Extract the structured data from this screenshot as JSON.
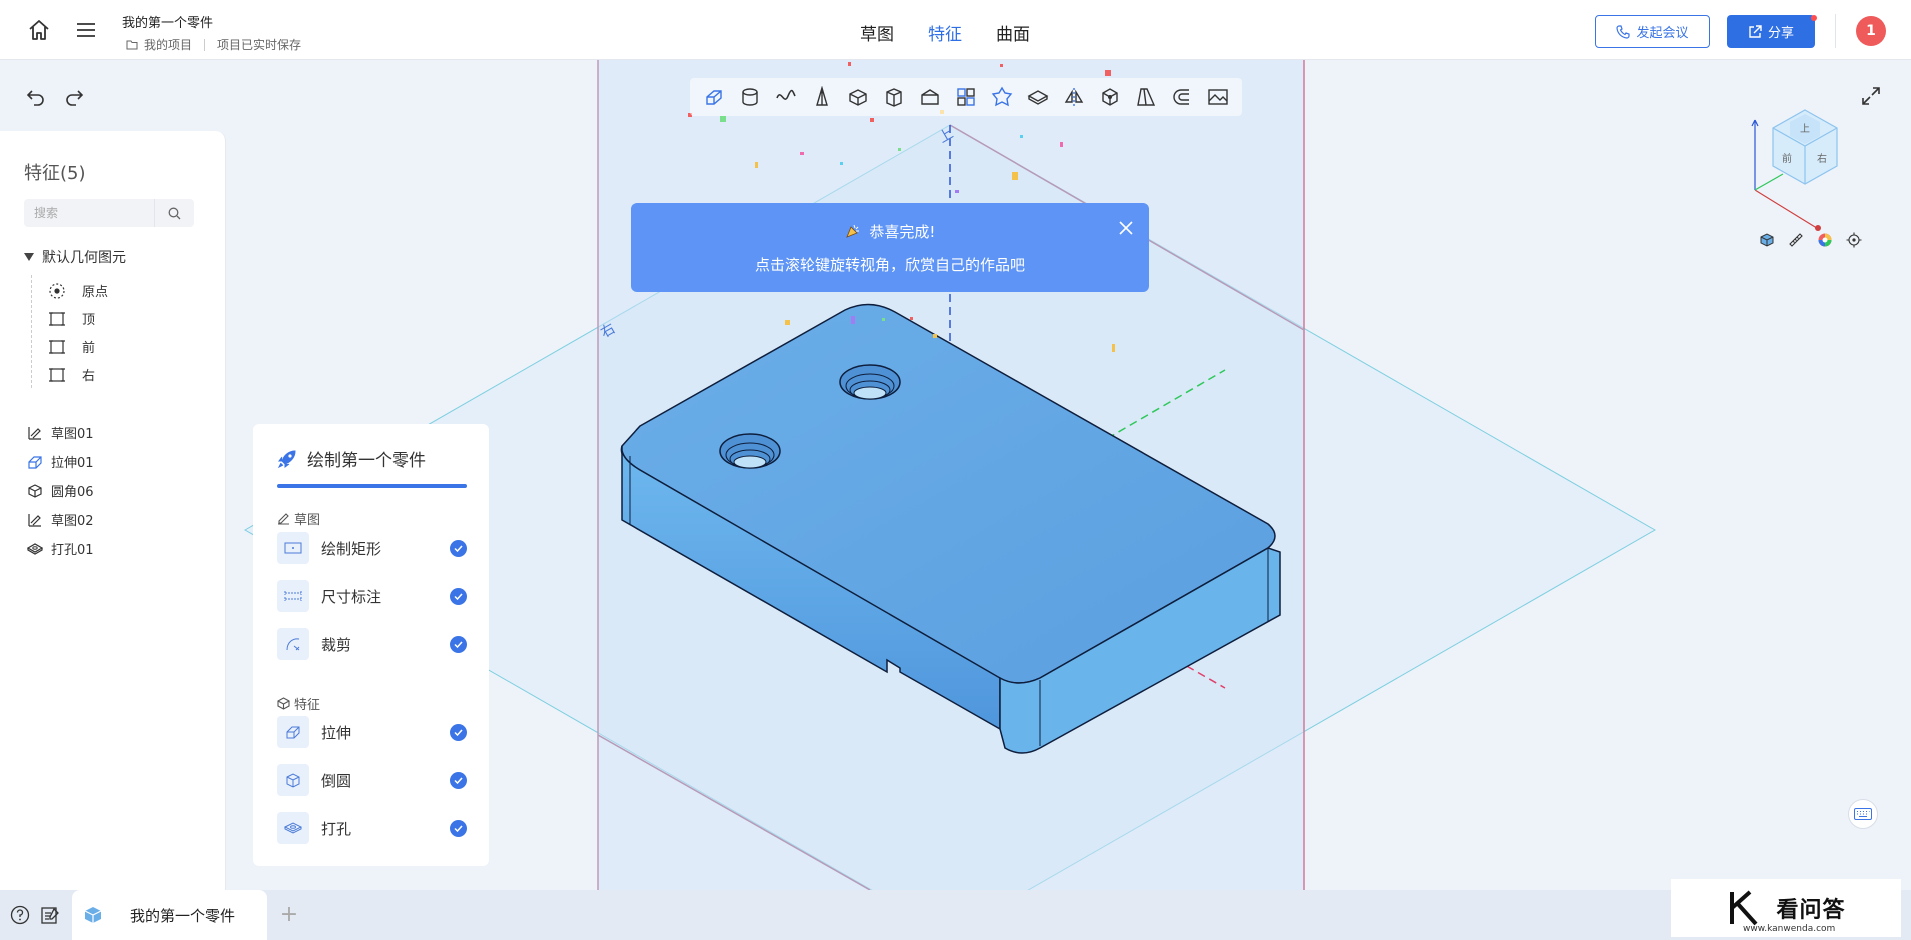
{
  "header": {
    "doc_title": "我的第一个零件",
    "breadcrumb_project": "我的项目",
    "save_status": "项目已实时保存",
    "tabs": [
      {
        "label": "草图",
        "active": false
      },
      {
        "label": "特征",
        "active": true
      },
      {
        "label": "曲面",
        "active": false
      }
    ],
    "meeting_label": "发起会议",
    "share_label": "分享",
    "avatar_label": "1",
    "accent_color": "#2f6fe4"
  },
  "sidebar": {
    "title": "特征(5)",
    "search_placeholder": "搜索",
    "group_label": "默认几何图元",
    "geometry": [
      {
        "label": "原点",
        "icon": "origin-icon"
      },
      {
        "label": "顶",
        "icon": "plane-icon"
      },
      {
        "label": "前",
        "icon": "plane-icon"
      },
      {
        "label": "右",
        "icon": "plane-icon"
      }
    ],
    "features": [
      {
        "label": "草图01",
        "icon": "sketch-icon"
      },
      {
        "label": "拉伸01",
        "icon": "extrude-icon"
      },
      {
        "label": "圆角06",
        "icon": "fillet-icon"
      },
      {
        "label": "草图02",
        "icon": "sketch-icon"
      },
      {
        "label": "打孔01",
        "icon": "hole-icon"
      }
    ]
  },
  "tutorial": {
    "title": "绘制第一个零件",
    "sections": [
      {
        "label": "草图",
        "steps": [
          {
            "label": "绘制矩形",
            "done": true
          },
          {
            "label": "尺寸标注",
            "done": true
          },
          {
            "label": "裁剪",
            "done": true
          }
        ]
      },
      {
        "label": "特征",
        "steps": [
          {
            "label": "拉伸",
            "done": true
          },
          {
            "label": "倒圆",
            "done": true
          },
          {
            "label": "打孔",
            "done": true
          }
        ]
      }
    ]
  },
  "popup": {
    "title": "恭喜完成!",
    "message": "点击滚轮键旋转视角，欣赏自己的作品吧",
    "title_icon": "party-popper-icon"
  },
  "viewport": {
    "plane_labels": {
      "top": "上",
      "right": "右"
    },
    "viewcube_labels": {
      "top": "上",
      "front": "前",
      "right": "右"
    }
  },
  "toolbar_tools": [
    "extrude-icon",
    "revolve-icon",
    "sweep-icon",
    "loft-icon",
    "shell-icon",
    "box-icon",
    "cylinder-icon",
    "pattern-icon",
    "fillet-icon",
    "chamfer-icon",
    "mirror-icon",
    "solid-icon",
    "draft-icon",
    "offset-icon",
    "image-icon"
  ],
  "footer": {
    "doc_tab_label": "我的第一个零件",
    "add_tab_label": "+"
  },
  "watermark": {
    "text": "看问答",
    "url_text": "www.kanwenda.com"
  }
}
